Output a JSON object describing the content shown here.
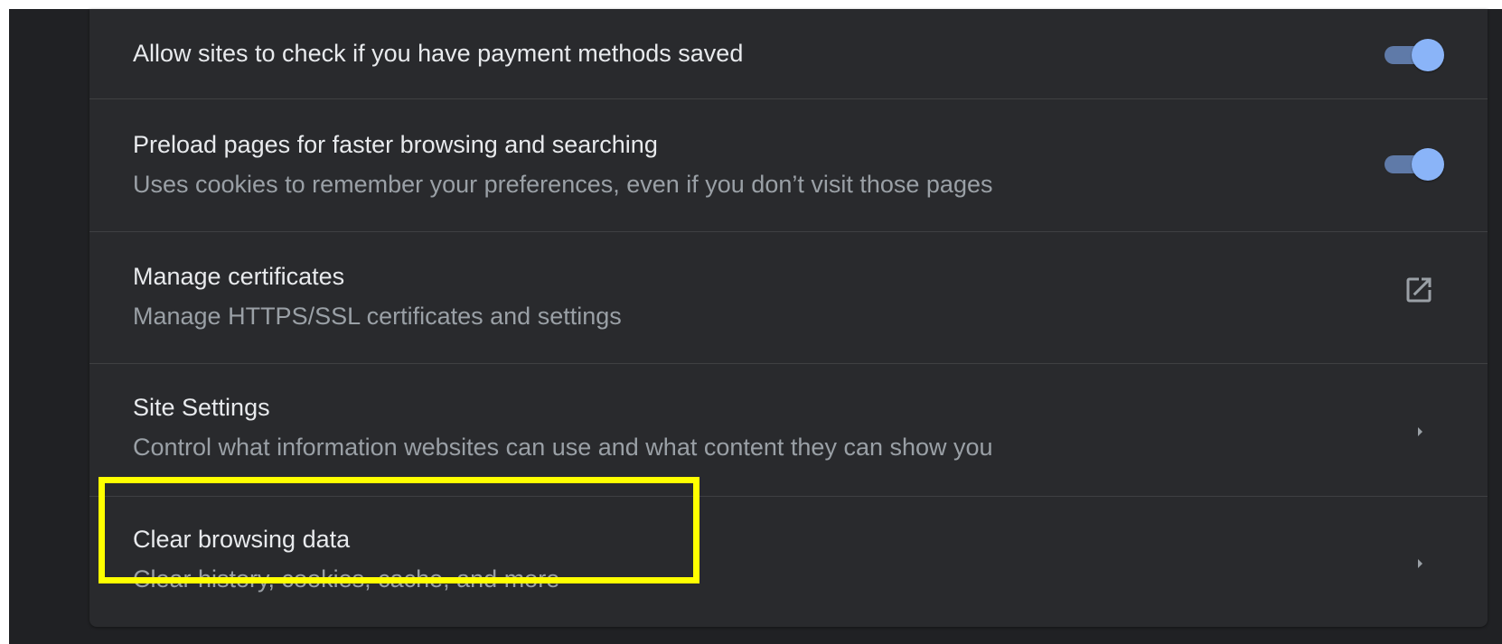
{
  "settings": {
    "payment_methods": {
      "title": "Allow sites to check if you have payment methods saved",
      "enabled": true
    },
    "preload_pages": {
      "title": "Preload pages for faster browsing and searching",
      "subtitle": "Uses cookies to remember your preferences, even if you don’t visit those pages",
      "enabled": true
    },
    "manage_certificates": {
      "title": "Manage certificates",
      "subtitle": "Manage HTTPS/SSL certificates and settings",
      "icon": "launch-icon"
    },
    "site_settings": {
      "title": "Site Settings",
      "subtitle": "Control what information websites can use and what content they can show you",
      "icon": "chevron-right-icon"
    },
    "clear_browsing_data": {
      "title": "Clear browsing data",
      "subtitle": "Clear history, cookies, cache, and more",
      "icon": "chevron-right-icon",
      "highlighted": true
    }
  },
  "colors": {
    "page_background": "#202124",
    "card_background": "#292a2d",
    "title_text": "#e8eaed",
    "subtitle_text": "#9aa0a6",
    "toggle_accent": "#8ab4f8",
    "highlight": "#ffff00"
  }
}
